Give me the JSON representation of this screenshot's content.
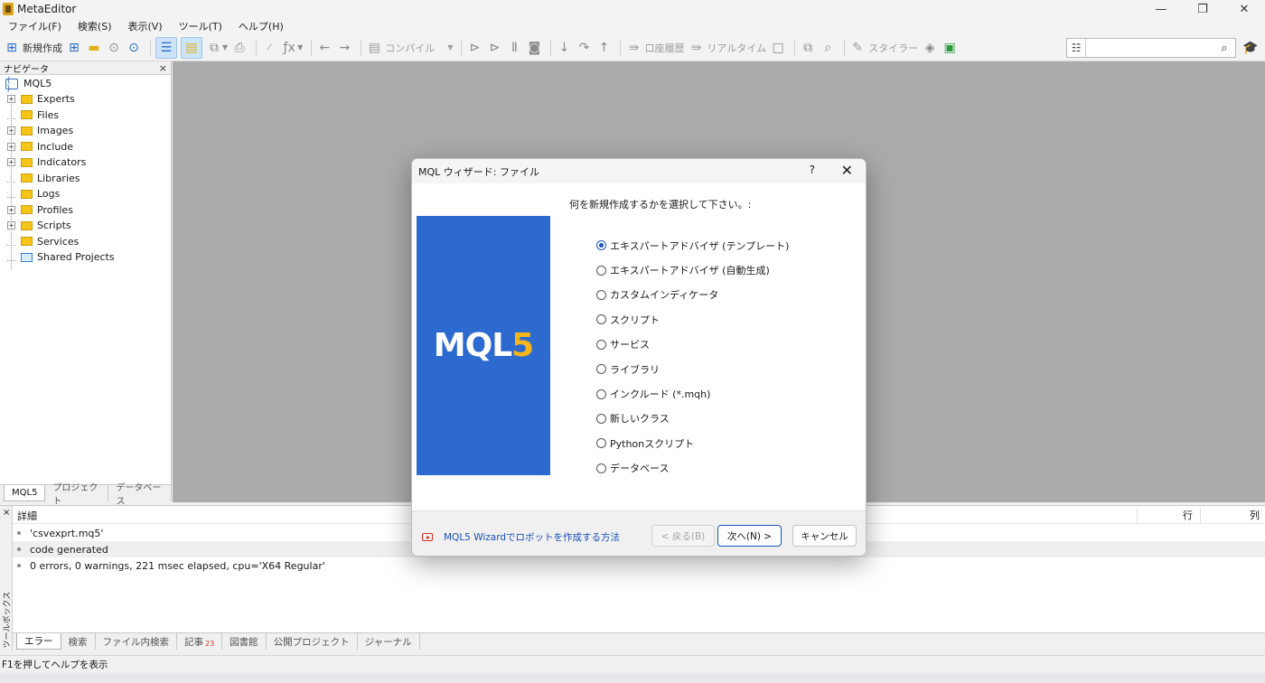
{
  "window": {
    "title": "MetaEditor",
    "min_icon": "—",
    "restore_icon": "❐",
    "close_icon": "✕"
  },
  "menu": [
    "ファイル(F)",
    "検索(S)",
    "表示(V)",
    "ツール(T)",
    "ヘルプ(H)"
  ],
  "toolbar": {
    "new_label": "新規作成",
    "compile_label": "コンパイル",
    "account_history_label": "口座履歴",
    "realtime_label": "リアルタイム",
    "styler_label": "スタイラー",
    "search_placeholder": ""
  },
  "navigator": {
    "title": "ナビゲータ",
    "close_icon": "×",
    "root": "MQL5",
    "items": [
      {
        "label": "Experts",
        "expandable": true
      },
      {
        "label": "Files",
        "expandable": false
      },
      {
        "label": "Images",
        "expandable": true
      },
      {
        "label": "Include",
        "expandable": true
      },
      {
        "label": "Indicators",
        "expandable": true
      },
      {
        "label": "Libraries",
        "expandable": false
      },
      {
        "label": "Logs",
        "expandable": false
      },
      {
        "label": "Profiles",
        "expandable": true
      },
      {
        "label": "Scripts",
        "expandable": true
      },
      {
        "label": "Services",
        "expandable": false
      },
      {
        "label": "Shared Projects",
        "expandable": false
      }
    ],
    "tabs": [
      "MQL5",
      "プロジェクト",
      "データベース"
    ]
  },
  "toolbox": {
    "close_icon": "×",
    "side_label": "ツールボックス",
    "columns": {
      "detail": "詳細",
      "line": "行",
      "col": "列"
    },
    "rows": [
      "'csvexprt.mq5'",
      "code generated",
      "0 errors, 0 warnings, 221 msec elapsed, cpu='X64 Regular'"
    ],
    "tabs": [
      "エラー",
      "検索",
      "ファイル内検索",
      "記事",
      "図書館",
      "公開プロジェクト",
      "ジャーナル"
    ],
    "articles_badge": "23"
  },
  "statusbar": {
    "text": "F1を押してヘルプを表示"
  },
  "dialog": {
    "title": "MQL ウィザード: ファイル",
    "help_icon": "?",
    "close_icon": "✕",
    "prompt": "何を新規作成するかを選択して下さい。:",
    "logo_text_main": "MQL",
    "logo_text_num": "5",
    "options": [
      {
        "label": "エキスパートアドバイザ (テンプレート)",
        "checked": true
      },
      {
        "label": "エキスパートアドバイザ (自動生成)",
        "checked": false
      },
      {
        "label": "カスタムインディケータ",
        "checked": false
      },
      {
        "label": "スクリプト",
        "checked": false
      },
      {
        "label": "サービス",
        "checked": false
      },
      {
        "label": "ライブラリ",
        "checked": false
      },
      {
        "label": "インクルード (*.mqh)",
        "checked": false
      },
      {
        "label": "新しいクラス",
        "checked": false
      },
      {
        "label": "Pythonスクリプト",
        "checked": false
      },
      {
        "label": "データベース",
        "checked": false
      }
    ],
    "link": "MQL5 Wizardでロボットを作成する方法",
    "back_button": "< 戻る(B)",
    "next_button": "次へ(N) >",
    "cancel_button": "キャンセル"
  }
}
